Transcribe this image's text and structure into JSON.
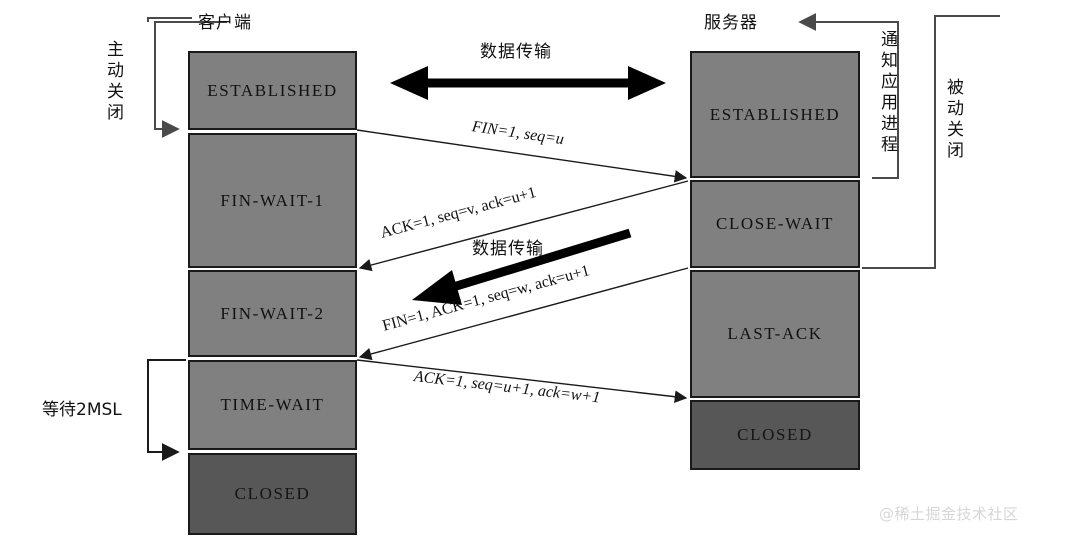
{
  "diagram": {
    "title_client": "客户端",
    "title_server": "服务器",
    "watermark": "@稀土掘金技术社区"
  },
  "annotations": {
    "active_close": "主动关闭",
    "passive_close": "被动关闭",
    "notify_app_process": "通知应用进程",
    "wait_2msl": "等待2MSL",
    "data_transfer_top": "数据传输",
    "data_transfer_mid": "数据传输"
  },
  "client_states": [
    {
      "label": "ESTABLISHED",
      "tone": "light"
    },
    {
      "label": "FIN-WAIT-1",
      "tone": "light"
    },
    {
      "label": "FIN-WAIT-2",
      "tone": "light"
    },
    {
      "label": "TIME-WAIT",
      "tone": "light"
    },
    {
      "label": "CLOSED",
      "tone": "dark"
    }
  ],
  "server_states": [
    {
      "label": "ESTABLISHED",
      "tone": "light"
    },
    {
      "label": "CLOSE-WAIT",
      "tone": "light"
    },
    {
      "label": "LAST-ACK",
      "tone": "light"
    },
    {
      "label": "CLOSED",
      "tone": "dark"
    }
  ],
  "messages": [
    {
      "text": "FIN=1,  seq=u",
      "direction": "client-to-server"
    },
    {
      "text": "ACK=1, seq=v, ack=u+1",
      "direction": "server-to-client"
    },
    {
      "text": "FIN=1,  ACK=1,  seq=w, ack=u+1",
      "direction": "server-to-client"
    },
    {
      "text": "ACK=1, seq=u+1, ack=w+1",
      "direction": "client-to-server"
    }
  ],
  "colors": {
    "box_light": "#808080",
    "box_dark": "#575757",
    "stroke": "#1a1a1a",
    "text": "#111111",
    "watermark": "#d6d6d6",
    "background": "#ffffff"
  }
}
